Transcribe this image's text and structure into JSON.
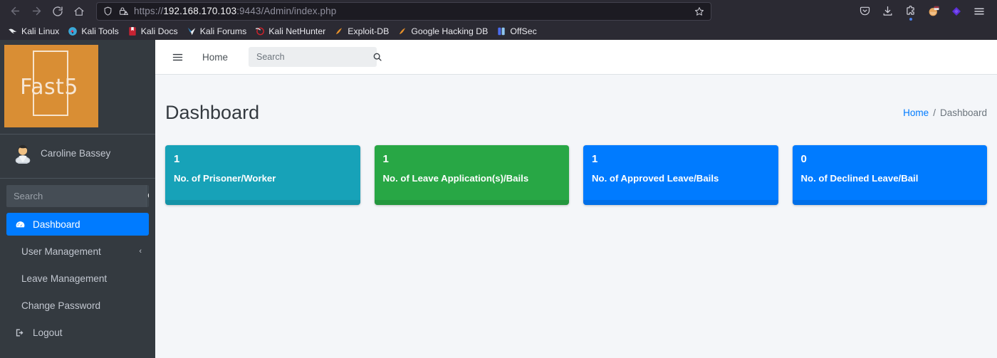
{
  "browser": {
    "nav": {
      "back_icon": "arrow-left-icon",
      "forward_icon": "arrow-right-icon",
      "reload_icon": "reload-icon",
      "home_icon": "home-icon"
    },
    "url": {
      "scheme": "https://",
      "host": "192.168.170.103",
      "rest": ":9443/Admin/index.php",
      "full": "https://192.168.170.103:9443/Admin/index.php",
      "shield_icon": "shield-icon",
      "lock_warning_icon": "lock-warning-icon",
      "bookmark_star_icon": "star-icon"
    },
    "toolbar_icons": [
      "pocket-icon",
      "downloads-icon",
      "extensions-icon",
      "container-tabs-icon",
      "purple-diamond-icon",
      "app-menu-icon"
    ],
    "bookmarks": [
      {
        "label": "Kali Linux",
        "icon": "kali-dragon-icon"
      },
      {
        "label": "Kali Tools",
        "icon": "kali-tools-icon"
      },
      {
        "label": "Kali Docs",
        "icon": "kali-docs-icon"
      },
      {
        "label": "Kali Forums",
        "icon": "kali-forums-icon"
      },
      {
        "label": "Kali NetHunter",
        "icon": "kali-nethunter-icon"
      },
      {
        "label": "Exploit-DB",
        "icon": "exploit-db-icon"
      },
      {
        "label": "Google Hacking DB",
        "icon": "google-hacking-db-icon"
      },
      {
        "label": "OffSec",
        "icon": "offsec-icon"
      }
    ]
  },
  "sidebar": {
    "brand": {
      "text": "Fast5"
    },
    "user": {
      "name": "Caroline Bassey",
      "avatar_icon": "user-avatar-icon"
    },
    "search": {
      "placeholder": "Search",
      "value": "",
      "button_icon": "search-icon"
    },
    "items": [
      {
        "label": "Dashboard",
        "icon": "tachometer-icon",
        "active": true
      },
      {
        "label": "User Management",
        "icon": "",
        "chevron": "‹",
        "active": false
      },
      {
        "label": "Leave Management",
        "icon": "",
        "active": false
      },
      {
        "label": "Change Password",
        "icon": "",
        "active": false
      },
      {
        "label": "Logout",
        "icon": "sign-out-icon",
        "active": false
      }
    ]
  },
  "navbar": {
    "hamburger_icon": "hamburger-icon",
    "home_label": "Home",
    "search": {
      "placeholder": "Search",
      "value": "",
      "icon": "search-icon"
    }
  },
  "page": {
    "title": "Dashboard",
    "breadcrumb": {
      "home": "Home",
      "separator": "/",
      "current": "Dashboard"
    }
  },
  "cards": [
    {
      "value": "1",
      "label": "No. of Prisoner/Worker",
      "color": "#17a2b8"
    },
    {
      "value": "1",
      "label": "No. of Leave Application(s)/Bails",
      "color": "#28a745"
    },
    {
      "value": "1",
      "label": "No. of Approved Leave/Bails",
      "color": "#007bff"
    },
    {
      "value": "0",
      "label": "No. of Declined Leave/Bail",
      "color": "#007bff"
    }
  ],
  "colors": {
    "sidebar_bg": "#343a40",
    "content_bg": "#f4f6f9",
    "accent": "#007bff",
    "brand_orange": "#d98e34",
    "teal": "#17a2b8",
    "green": "#28a745"
  }
}
